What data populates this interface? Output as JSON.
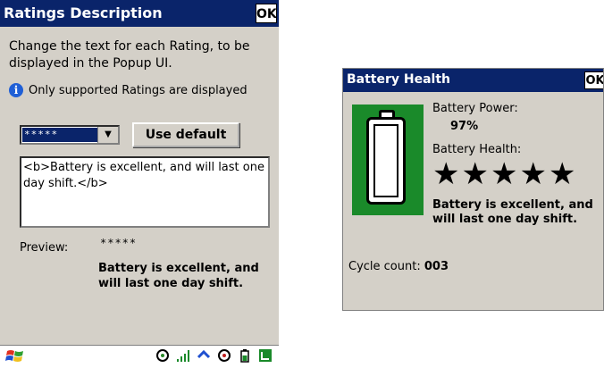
{
  "left_window": {
    "title": "Ratings Description",
    "ok_label": "OK",
    "description": "Change the text for each Rating, to be displayed in the Popup UI.",
    "info_text": "Only supported Ratings are displayed",
    "rating_select_value": "*****",
    "use_default_label": "Use default",
    "edit_text": "<b>Battery is excellent, and will last one day shift.</b>",
    "preview_label": "Preview:",
    "preview_stars": "*****",
    "preview_text": "Battery is excellent, and will last one day shift."
  },
  "right_window": {
    "title": "Battery Health",
    "ok_label": "OK",
    "battery_power_label": "Battery Power:",
    "battery_power_value": "97%",
    "battery_health_label": "Battery Health:",
    "battery_health_rating": 5,
    "health_text": "Battery is excellent, and will last one day shift.",
    "cycle_label": "Cycle count:",
    "cycle_value": "003"
  },
  "colors": {
    "titlebar": "#0a246a",
    "window_bg": "#d4d0c8",
    "battery_bg": "#1a8a2a"
  },
  "taskbar": {
    "icons": [
      "start-windows-icon",
      "network-icon",
      "signal-bars-icon",
      "sync-icon",
      "network-icon-2",
      "battery-icon",
      "connection-icon"
    ]
  }
}
